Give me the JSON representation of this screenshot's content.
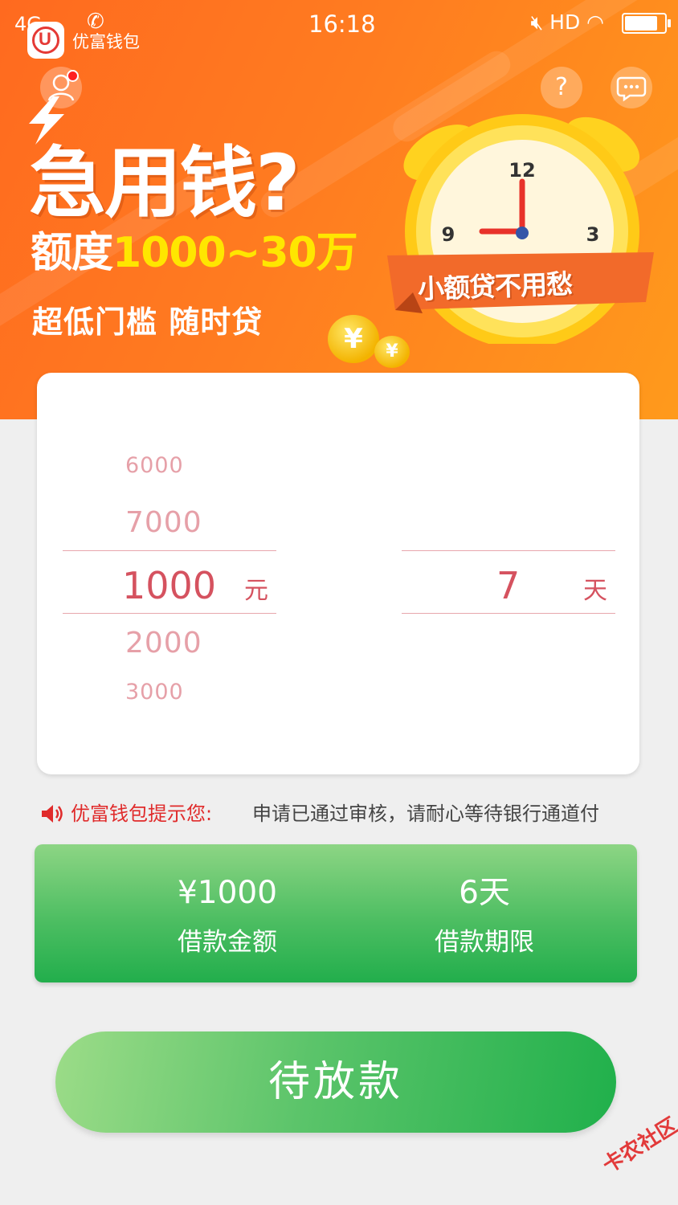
{
  "status_bar": {
    "signal": "4G",
    "time": "16:18",
    "network": "HD",
    "battery_level": 0.9
  },
  "app": {
    "name": "优富钱包"
  },
  "banner": {
    "headline": "急用钱?",
    "amount_prefix": "额度",
    "amount_range": "1000~30万",
    "features": "超低门槛  随时贷",
    "ribbon": "小额贷不用愁",
    "clock_numbers": [
      "12",
      "3",
      "9"
    ],
    "coin_symbol": "¥"
  },
  "picker": {
    "amount_options_above": [
      "6000",
      "7000"
    ],
    "amount_selected": "1000",
    "amount_unit": "元",
    "amount_options_below": [
      "2000",
      "3000"
    ],
    "days_selected": "7",
    "days_unit": "天"
  },
  "notice": {
    "label": "优富钱包提示您:",
    "message": "申请已通过审核，请耐心等待银行通道付"
  },
  "summary": {
    "amount_value": "¥1000",
    "amount_label": "借款金额",
    "term_value": "6天",
    "term_label": "借款期限"
  },
  "action_button": {
    "label": "待放款"
  },
  "watermark": "卡农社区",
  "colors": {
    "banner_orange": "#ff7a1e",
    "highlight_yellow": "#ffe600",
    "picker_red": "#d5525f",
    "green": "#22ae4c",
    "notice_red": "#e02b2b"
  }
}
